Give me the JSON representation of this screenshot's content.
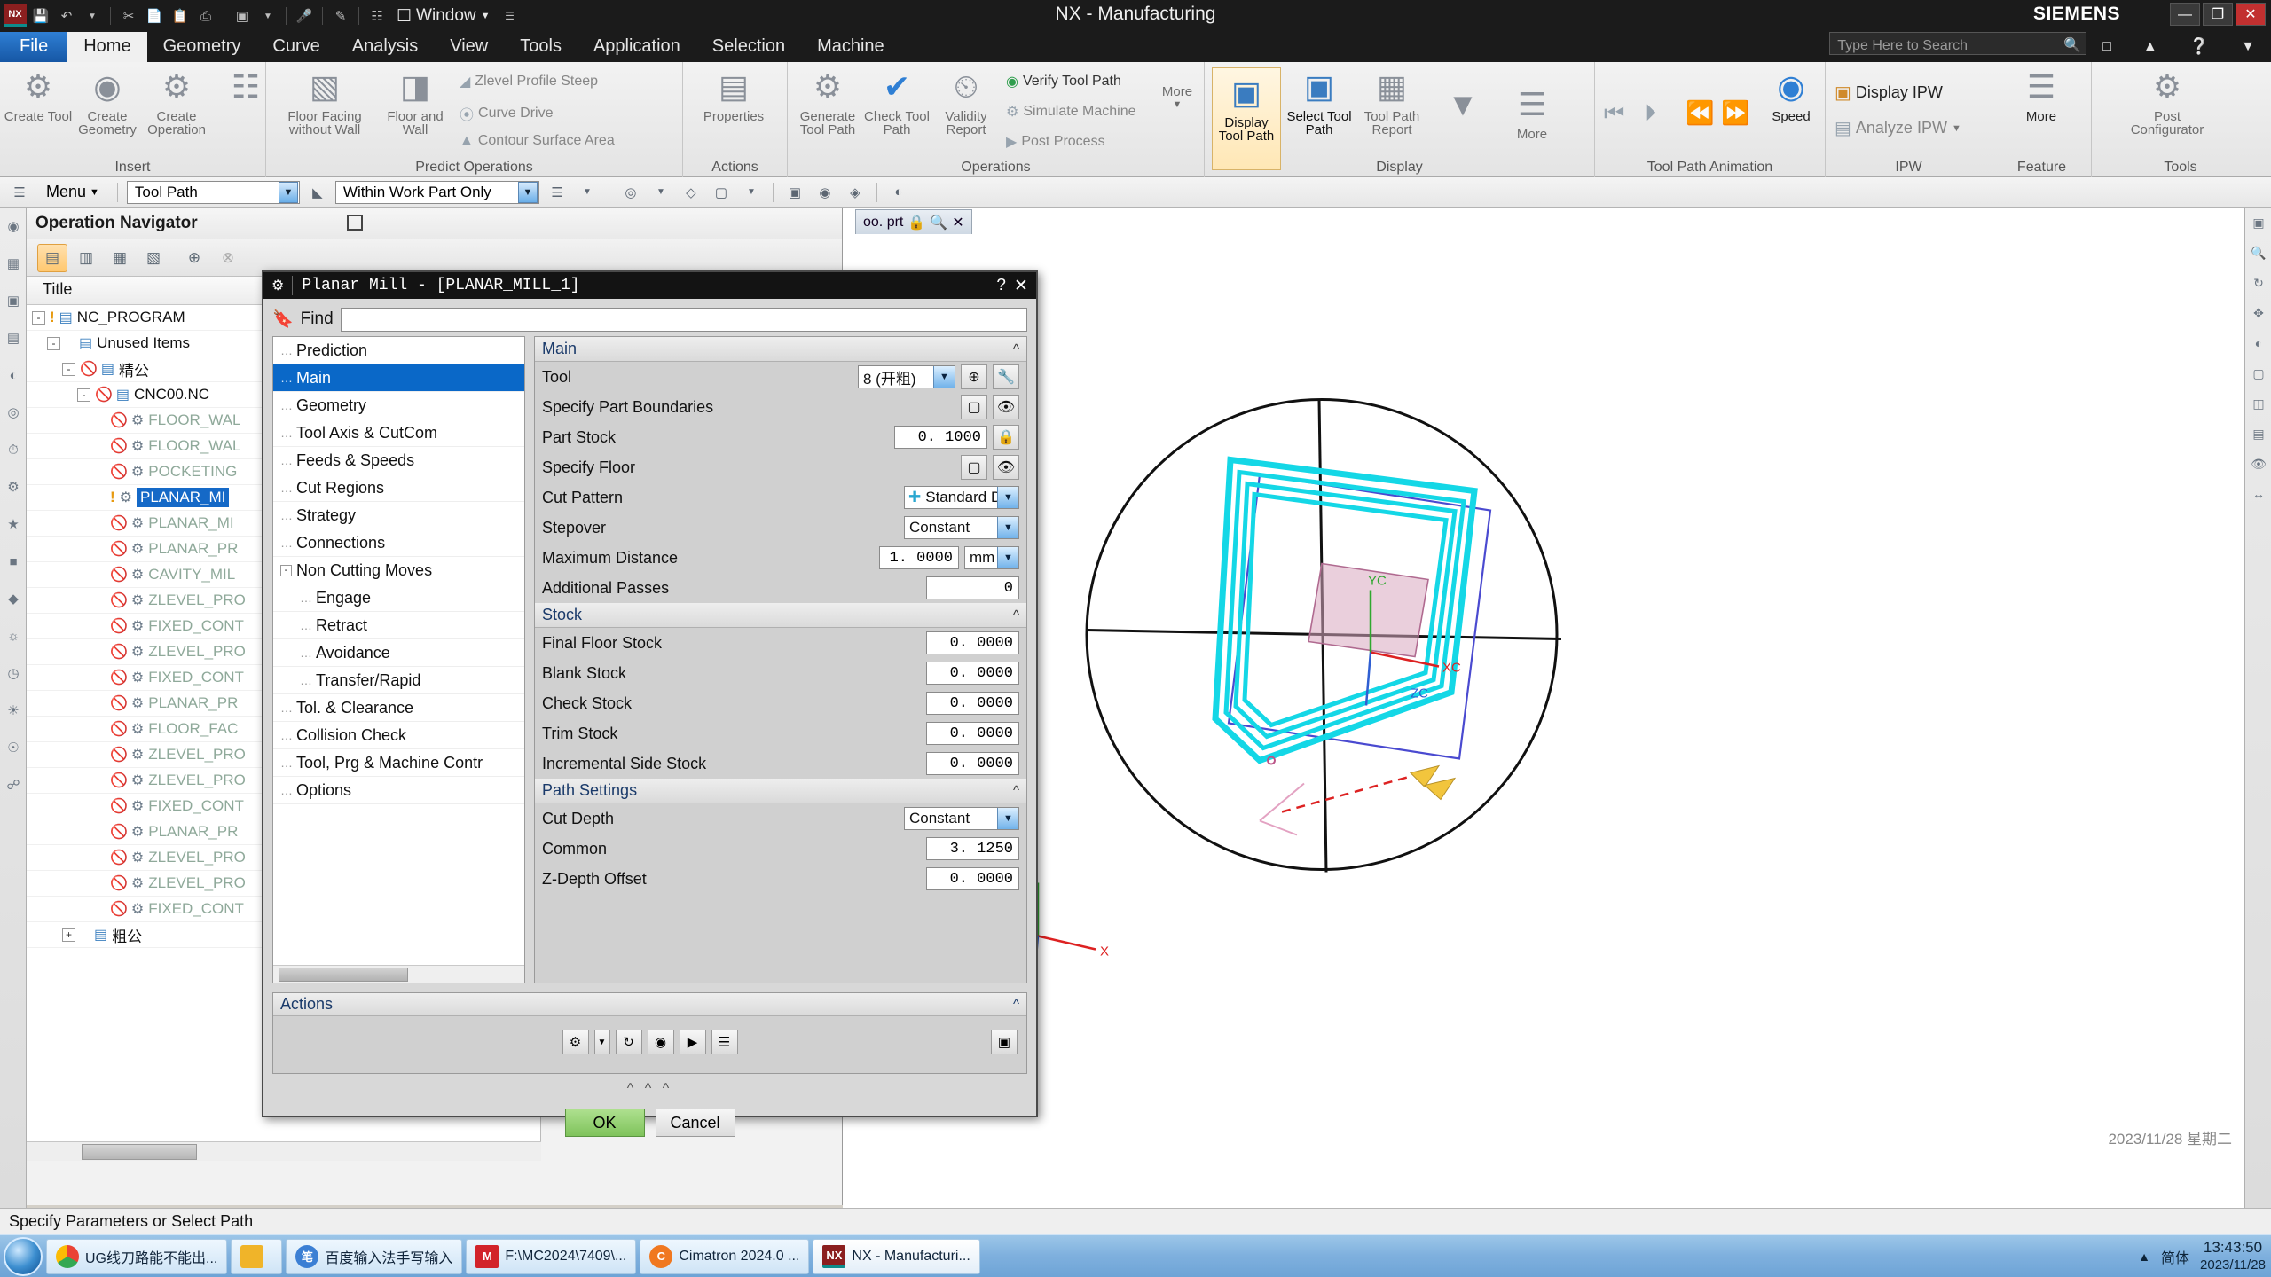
{
  "window": {
    "title": "NX - Manufacturing",
    "brand": "SIEMENS",
    "quick_access": {
      "logo": "NX",
      "icons": [
        "save-icon",
        "undo-icon",
        "undo-caret",
        "cut-icon",
        "copy-icon",
        "paste-icon",
        "paste-special-icon",
        "info-icon",
        "info-caret",
        "microphone-icon",
        "eraser-icon",
        "layout-icon"
      ],
      "window_label": "Window"
    },
    "buttons": {
      "minimize": "—",
      "maximize": "❐",
      "close": "✕"
    }
  },
  "tabs": [
    {
      "label": "File",
      "active": false,
      "file": true
    },
    {
      "label": "Home",
      "active": true
    },
    {
      "label": "Geometry",
      "active": false
    },
    {
      "label": "Curve",
      "active": false
    },
    {
      "label": "Analysis",
      "active": false
    },
    {
      "label": "View",
      "active": false
    },
    {
      "label": "Tools",
      "active": false
    },
    {
      "label": "Application",
      "active": false
    },
    {
      "label": "Selection",
      "active": false
    },
    {
      "label": "Machine",
      "active": false
    }
  ],
  "ribbon": {
    "groups": [
      {
        "name": "Insert",
        "big": [
          {
            "label": "Create Tool",
            "icon": "create-tool-icon"
          },
          {
            "label": "Create Geometry",
            "icon": "create-geometry-icon"
          },
          {
            "label": "Create Operation",
            "icon": "create-operation-icon"
          }
        ],
        "small": [
          {
            "label": "",
            "icon": "create-program-icon"
          }
        ]
      },
      {
        "name": "Predict Operations",
        "big": [
          {
            "label": "Floor Facing without Wall",
            "icon": "floor-facing-icon"
          },
          {
            "label": "Floor and Wall",
            "icon": "floor-and-wall-icon"
          }
        ],
        "small": [
          {
            "label": "Zlevel Profile Steep",
            "icon": "zlevel-profile-steep-icon"
          },
          {
            "label": "Curve Drive",
            "icon": "curve-drive-icon"
          },
          {
            "label": "Contour Surface Area",
            "icon": "contour-surface-area-icon"
          }
        ]
      },
      {
        "name": "Actions",
        "big": [
          {
            "label": "Properties",
            "icon": "properties-icon"
          }
        ]
      },
      {
        "name": "Operations",
        "big": [
          {
            "label": "Generate Tool Path",
            "icon": "generate-tool-path-icon"
          },
          {
            "label": "Check Tool Path",
            "icon": "check-tool-path-icon"
          },
          {
            "label": "Validity Report",
            "icon": "validity-report-icon"
          }
        ],
        "small": [
          {
            "label": "Verify Tool Path",
            "icon": "verify-tool-path-icon"
          },
          {
            "label": "Simulate Machine",
            "icon": "simulate-machine-icon"
          },
          {
            "label": "Post Process",
            "icon": "post-process-icon"
          }
        ],
        "more": "More"
      },
      {
        "name": "Display",
        "big": [
          {
            "label": "Display Tool Path",
            "icon": "display-tool-path-icon"
          },
          {
            "label": "Select Tool Path",
            "icon": "select-tool-path-icon"
          },
          {
            "label": "Tool Path Report",
            "icon": "tool-path-report-icon"
          }
        ],
        "small": [
          {
            "label": "",
            "icon": "filter-icon"
          }
        ],
        "more": "More"
      },
      {
        "name": "Tool Path Animation",
        "big": [
          {
            "label": "Speed",
            "icon": "speed-slider-icon"
          }
        ],
        "small": [
          {
            "label": "",
            "icon": "step-back-icon"
          },
          {
            "label": "",
            "icon": "play-icon"
          },
          {
            "label": "",
            "icon": "rewind-icon"
          },
          {
            "label": "",
            "icon": "forward-icon"
          }
        ]
      },
      {
        "name": "IPW",
        "big": [
          {
            "label": "Display IPW",
            "icon": "display-ipw-icon"
          }
        ],
        "small": [
          {
            "label": "Analyze IPW",
            "icon": "analyze-ipw-icon"
          }
        ]
      },
      {
        "name": "Feature",
        "big": [
          {
            "label": "More",
            "icon": "feature-more-icon"
          }
        ]
      },
      {
        "name": "Tools",
        "big": [
          {
            "label": "Post Configurator",
            "icon": "post-configurator-icon"
          }
        ]
      }
    ]
  },
  "selection_bar": {
    "menu_label": "Menu",
    "type_filter": {
      "value": "Tool Path",
      "options": [
        "Tool Path"
      ]
    },
    "scope_filter": {
      "value": "Within Work Part Only",
      "options": [
        "Within Work Part Only"
      ]
    },
    "icons": [
      "snap-filter-icon",
      "select-list-icon",
      "point-icon",
      "face-icon",
      "curve-icon",
      "wcs-icon",
      "mcs-icon",
      "view-icon",
      "render-icon"
    ]
  },
  "operation_navigator": {
    "title": "Operation Navigator",
    "toolbar_icons": [
      "program-order-view-icon",
      "machine-tool-view-icon",
      "geometry-view-icon",
      "machining-method-view-icon",
      "create-object-icon",
      "delete-object-icon"
    ],
    "column_header": "Title",
    "rows": [
      {
        "indent": 0,
        "expander": "-",
        "flag": "warning",
        "icon": "program-group-icon",
        "label": "NC_PROGRAM",
        "dark": true,
        "selected": false
      },
      {
        "indent": 1,
        "expander": "-",
        "flag": "none",
        "icon": "program-group-icon",
        "label": "Unused Items",
        "dark": true,
        "selected": false
      },
      {
        "indent": 2,
        "expander": "-",
        "flag": "blocked",
        "icon": "program-group-icon",
        "label": "精公",
        "dark": true,
        "selected": false
      },
      {
        "indent": 3,
        "expander": "-",
        "flag": "blocked",
        "icon": "program-group-icon",
        "label": "CNC00.NC",
        "dark": true,
        "selected": false
      },
      {
        "indent": 4,
        "expander": "",
        "flag": "blocked",
        "icon": "operation-icon",
        "label": "FLOOR_WAL",
        "dark": false,
        "selected": false
      },
      {
        "indent": 4,
        "expander": "",
        "flag": "blocked",
        "icon": "operation-icon",
        "label": "FLOOR_WAL",
        "dark": false,
        "selected": false
      },
      {
        "indent": 4,
        "expander": "",
        "flag": "blocked",
        "icon": "operation-icon",
        "label": "POCKETING",
        "dark": false,
        "selected": false
      },
      {
        "indent": 4,
        "expander": "",
        "flag": "warning",
        "icon": "operation-icon",
        "label": "PLANAR_MI",
        "dark": false,
        "selected": true
      },
      {
        "indent": 4,
        "expander": "",
        "flag": "blocked",
        "icon": "operation-icon",
        "label": "PLANAR_MI",
        "dark": false,
        "selected": false
      },
      {
        "indent": 4,
        "expander": "",
        "flag": "blocked",
        "icon": "operation-icon",
        "label": "PLANAR_PR",
        "dark": false,
        "selected": false
      },
      {
        "indent": 4,
        "expander": "",
        "flag": "blocked",
        "icon": "operation-icon",
        "label": "CAVITY_MIL",
        "dark": false,
        "selected": false
      },
      {
        "indent": 4,
        "expander": "",
        "flag": "blocked",
        "icon": "operation-icon",
        "label": "ZLEVEL_PRO",
        "dark": false,
        "selected": false
      },
      {
        "indent": 4,
        "expander": "",
        "flag": "blocked",
        "icon": "operation-icon",
        "label": "FIXED_CONT",
        "dark": false,
        "selected": false
      },
      {
        "indent": 4,
        "expander": "",
        "flag": "blocked",
        "icon": "operation-icon",
        "label": "ZLEVEL_PRO",
        "dark": false,
        "selected": false
      },
      {
        "indent": 4,
        "expander": "",
        "flag": "blocked",
        "icon": "operation-icon",
        "label": "FIXED_CONT",
        "dark": false,
        "selected": false
      },
      {
        "indent": 4,
        "expander": "",
        "flag": "blocked",
        "icon": "operation-icon",
        "label": "PLANAR_PR",
        "dark": false,
        "selected": false
      },
      {
        "indent": 4,
        "expander": "",
        "flag": "blocked",
        "icon": "operation-icon",
        "label": "FLOOR_FAC",
        "dark": false,
        "selected": false
      },
      {
        "indent": 4,
        "expander": "",
        "flag": "blocked",
        "icon": "operation-icon",
        "label": "ZLEVEL_PRO",
        "dark": false,
        "selected": false
      },
      {
        "indent": 4,
        "expander": "",
        "flag": "blocked",
        "icon": "operation-icon",
        "label": "ZLEVEL_PRO",
        "dark": false,
        "selected": false
      },
      {
        "indent": 4,
        "expander": "",
        "flag": "blocked",
        "icon": "operation-icon",
        "label": "FIXED_CONT",
        "dark": false,
        "selected": false
      },
      {
        "indent": 4,
        "expander": "",
        "flag": "blocked",
        "icon": "operation-icon",
        "label": "PLANAR_PR",
        "dark": false,
        "selected": false
      },
      {
        "indent": 4,
        "expander": "",
        "flag": "blocked",
        "icon": "operation-icon",
        "label": "ZLEVEL_PRO",
        "dark": false,
        "selected": false
      },
      {
        "indent": 4,
        "expander": "",
        "flag": "blocked",
        "icon": "operation-icon",
        "label": "ZLEVEL_PRO",
        "dark": false,
        "selected": false
      },
      {
        "indent": 4,
        "expander": "",
        "flag": "blocked",
        "icon": "operation-icon",
        "label": "FIXED_CONT",
        "dark": false,
        "selected": false
      },
      {
        "indent": 2,
        "expander": "+",
        "flag": "none",
        "icon": "program-group-icon",
        "label": "粗公",
        "dark": true,
        "selected": false
      }
    ]
  },
  "graphics": {
    "tab_label": "oo. prt",
    "tab_icons": [
      "lock-icon",
      "search-icon",
      "close-icon"
    ],
    "watermark": "2023/11/28 星期二",
    "axis_labels": [
      "YC",
      "XC",
      "ZC"
    ]
  },
  "dialog": {
    "title": "Planar Mill - [PLANAR_MILL_1]",
    "titlebar_icons": {
      "gear": "gear-icon",
      "help": "?",
      "close": "✕"
    },
    "find": {
      "label": "Find",
      "value": "",
      "placeholder": ""
    },
    "tree": [
      {
        "label": "Prediction",
        "indent": 0,
        "expander": "",
        "selected": false
      },
      {
        "label": "Main",
        "indent": 0,
        "expander": "",
        "selected": true
      },
      {
        "label": "Geometry",
        "indent": 0,
        "expander": "",
        "selected": false
      },
      {
        "label": "Tool Axis & CutCom",
        "indent": 0,
        "expander": "",
        "selected": false
      },
      {
        "label": "Feeds & Speeds",
        "indent": 0,
        "expander": "",
        "selected": false
      },
      {
        "label": "Cut Regions",
        "indent": 0,
        "expander": "",
        "selected": false
      },
      {
        "label": "Strategy",
        "indent": 0,
        "expander": "",
        "selected": false
      },
      {
        "label": "Connections",
        "indent": 0,
        "expander": "",
        "selected": false
      },
      {
        "label": "Non Cutting Moves",
        "indent": 0,
        "expander": "-",
        "selected": false
      },
      {
        "label": "Engage",
        "indent": 1,
        "expander": "",
        "selected": false
      },
      {
        "label": "Retract",
        "indent": 1,
        "expander": "",
        "selected": false
      },
      {
        "label": "Avoidance",
        "indent": 1,
        "expander": "",
        "selected": false
      },
      {
        "label": "Transfer/Rapid",
        "indent": 1,
        "expander": "",
        "selected": false
      },
      {
        "label": "Tol. & Clearance",
        "indent": 0,
        "expander": "",
        "selected": false
      },
      {
        "label": "Collision Check",
        "indent": 0,
        "expander": "",
        "selected": false
      },
      {
        "label": "Tool, Prg & Machine Contr",
        "indent": 0,
        "expander": "",
        "selected": false
      },
      {
        "label": "Options",
        "indent": 0,
        "expander": "",
        "selected": false
      }
    ],
    "sections": [
      {
        "title": "Main",
        "fields": [
          {
            "type": "select-icons",
            "label": "Tool",
            "value": "8 (开粗)",
            "icons": [
              "new-tool-icon",
              "edit-tool-icon"
            ]
          },
          {
            "type": "icons-only",
            "label": "Specify Part Boundaries",
            "icons": [
              "select-boundary-icon",
              "display-boundary-icon"
            ]
          },
          {
            "type": "number-lock",
            "label": "Part Stock",
            "value": "0. 1000",
            "icons": [
              "lock-icon"
            ]
          },
          {
            "type": "icons-only",
            "label": "Specify Floor",
            "icons": [
              "select-floor-icon",
              "display-floor-icon"
            ]
          },
          {
            "type": "select",
            "label": "Cut Pattern",
            "value": "Standard Dr",
            "glyph": "cut-pattern-icon"
          },
          {
            "type": "select",
            "label": "Stepover",
            "value": "Constant"
          },
          {
            "type": "number-unit",
            "label": "Maximum Distance",
            "value": "1. 0000",
            "unit": "mm"
          },
          {
            "type": "number",
            "label": "Additional Passes",
            "value": "0"
          }
        ]
      },
      {
        "title": "Stock",
        "fields": [
          {
            "type": "number",
            "label": "Final Floor Stock",
            "value": "0. 0000"
          },
          {
            "type": "number",
            "label": "Blank Stock",
            "value": "0. 0000"
          },
          {
            "type": "number",
            "label": "Check Stock",
            "value": "0. 0000"
          },
          {
            "type": "number",
            "label": "Trim Stock",
            "value": "0. 0000"
          },
          {
            "type": "number",
            "label": "Incremental Side Stock",
            "value": "0. 0000"
          }
        ]
      },
      {
        "title": "Path Settings",
        "fields": [
          {
            "type": "select",
            "label": "Cut Depth",
            "value": "Constant"
          },
          {
            "type": "number",
            "label": "Common",
            "value": "3. 1250"
          },
          {
            "type": "number",
            "label": "Z-Depth Offset",
            "value": "0. 0000"
          }
        ]
      }
    ],
    "actions": {
      "title": "Actions",
      "icons": [
        "generate-icon",
        "generate-caret-icon",
        "replay-icon",
        "verify-icon",
        "simulate-icon",
        "list-icon"
      ],
      "right_icon": "transform-icon"
    },
    "buttons": {
      "ok": "OK",
      "cancel": "Cancel"
    }
  },
  "status_bar": {
    "message": "Specify Parameters or Select Path"
  },
  "taskbar": {
    "start": "start-orb",
    "items": [
      {
        "label": "UG线刀路能不能出...",
        "icon": "chrome-icon",
        "color": "#2e9e4d"
      },
      {
        "label": "",
        "icon": "folder-icon",
        "color": "#f0b429"
      },
      {
        "label": "百度输入法手写输入",
        "icon": "baidu-ime-icon",
        "color": "#3b7fd4"
      },
      {
        "label": "F:\\MC2024\\7409\\...",
        "icon": "mastercam-icon",
        "color": "#d2232a"
      },
      {
        "label": "Cimatron 2024.0 ...",
        "icon": "cimatron-icon",
        "color": "#f07820"
      },
      {
        "label": "NX - Manufacturi...",
        "icon": "nx-icon",
        "color": "#8b1f1f"
      }
    ],
    "tray": {
      "ime": "简体",
      "time": "13:43:50",
      "date": "2023/11/28",
      "caret": "show-hidden-icons"
    }
  }
}
